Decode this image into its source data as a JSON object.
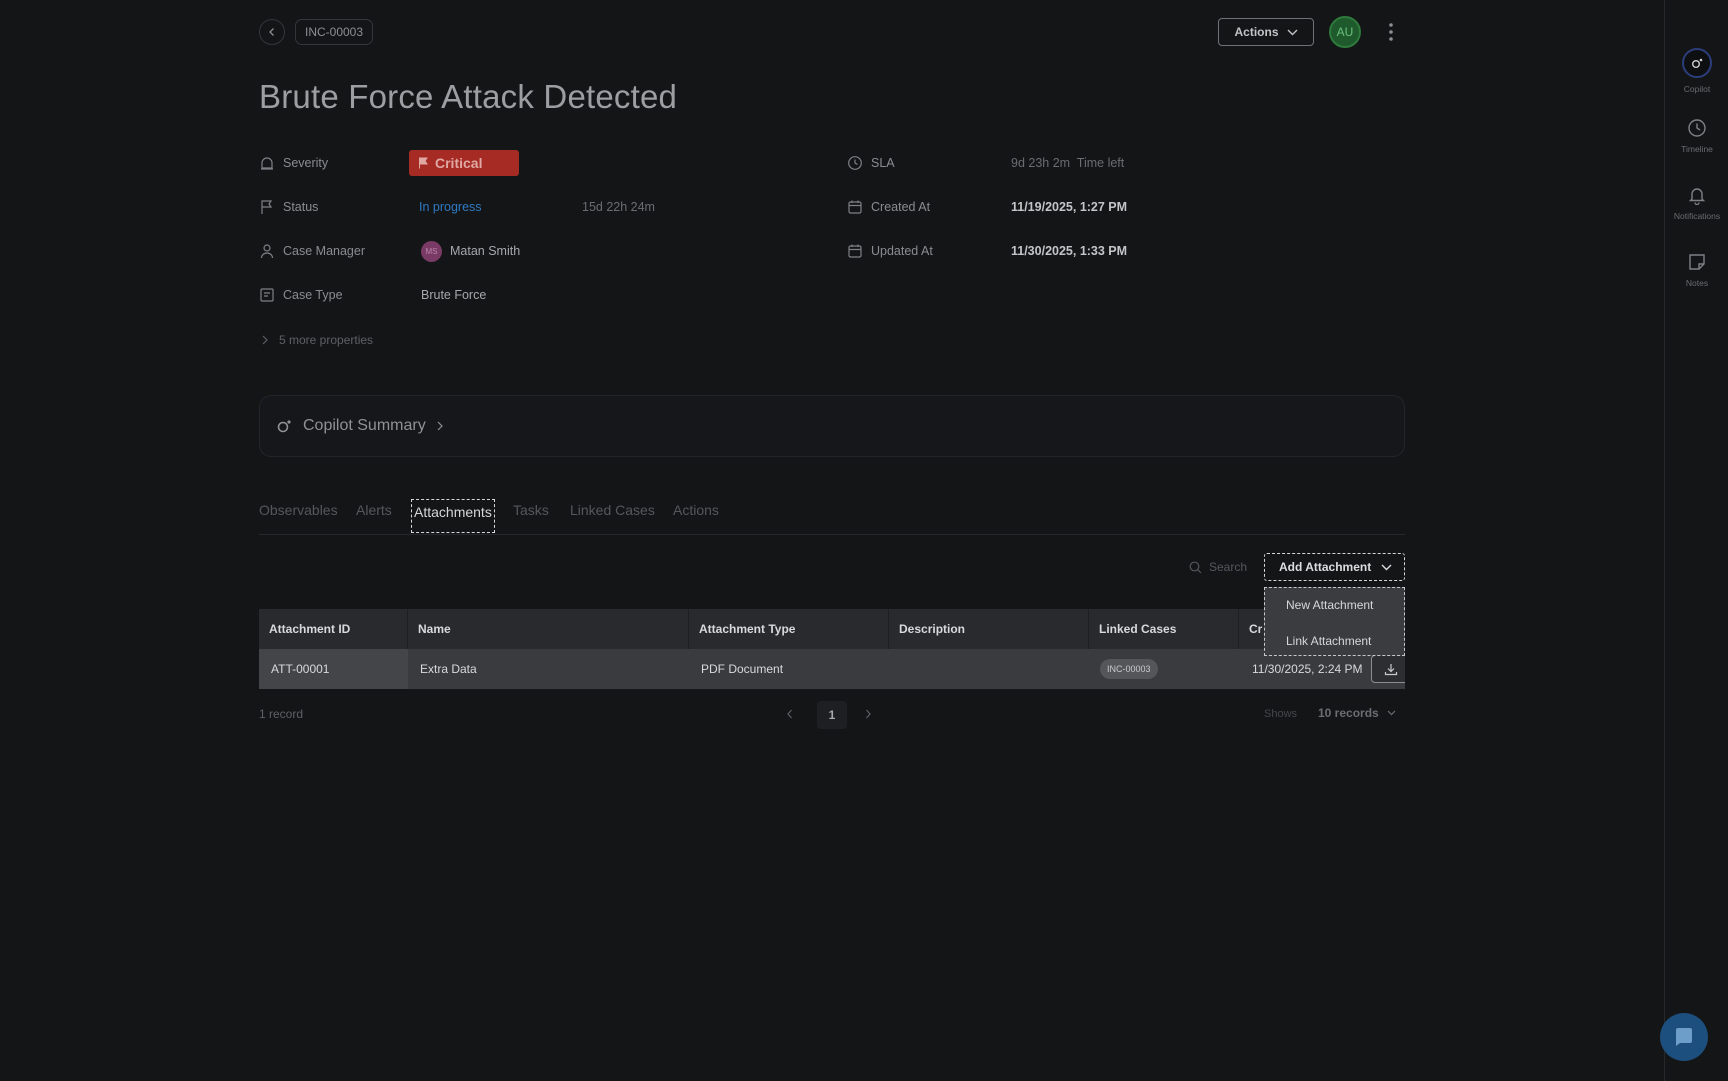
{
  "header": {
    "case_id": "INC-00003",
    "actions_label": "Actions",
    "user_initials": "AU",
    "title": "Brute Force Attack Detected"
  },
  "properties": {
    "severity_label": "Severity",
    "severity_value": "Critical",
    "status_label": "Status",
    "status_value": "In progress",
    "status_duration": "15d 22h 24m",
    "case_manager_label": "Case Manager",
    "case_manager_initials": "MS",
    "case_manager_value": "Matan Smith",
    "case_type_label": "Case Type",
    "case_type_value": "Brute Force",
    "more_properties": "5 more properties",
    "sla_label": "SLA",
    "sla_value": "9d 23h 2m  Time left",
    "created_label": "Created At",
    "created_value": "11/19/2025, 1:27 PM",
    "updated_label": "Updated At",
    "updated_value": "11/30/2025, 1:33 PM"
  },
  "copilot_summary": {
    "label": "Copilot Summary"
  },
  "tabs": [
    {
      "label": "Observables"
    },
    {
      "label": "Alerts"
    },
    {
      "label": "Attachments"
    },
    {
      "label": "Tasks"
    },
    {
      "label": "Linked Cases"
    },
    {
      "label": "Actions"
    }
  ],
  "toolbar": {
    "search_placeholder": "Search",
    "add_attachment_label": "Add Attachment",
    "menu": [
      {
        "label": "New Attachment"
      },
      {
        "label": "Link Attachment"
      }
    ]
  },
  "table": {
    "columns": [
      "Attachment ID",
      "Name",
      "Attachment Type",
      "Description",
      "Linked Cases",
      "Cr"
    ],
    "rows": [
      {
        "id": "ATT-00001",
        "name": "Extra Data",
        "type": "PDF Document",
        "description": "",
        "linked_case": "INC-00003",
        "created": "11/30/2025, 2:24 PM"
      }
    ]
  },
  "footer": {
    "record_count": "1 record",
    "current_page": "1",
    "shows_label": "Shows",
    "records_per_page": "10 records"
  },
  "rail": {
    "copilot": "Copilot",
    "timeline": "Timeline",
    "notifications": "Notifications",
    "notes": "Notes"
  },
  "colors": {
    "background": "#141517",
    "critical": "#a52b24",
    "status_link": "#2f7ac3",
    "avatar_green": "#1e5a2c",
    "chat_fab": "#1c4f7e"
  },
  "icons": [
    "chevron-left-icon",
    "chevron-down-icon",
    "kebab-icon",
    "siren-icon",
    "flag-icon",
    "user-icon",
    "document-icon",
    "clock-icon",
    "calendar-icon",
    "copilot-icon",
    "search-icon",
    "download-icon",
    "bell-icon",
    "note-icon",
    "chat-icon"
  ]
}
